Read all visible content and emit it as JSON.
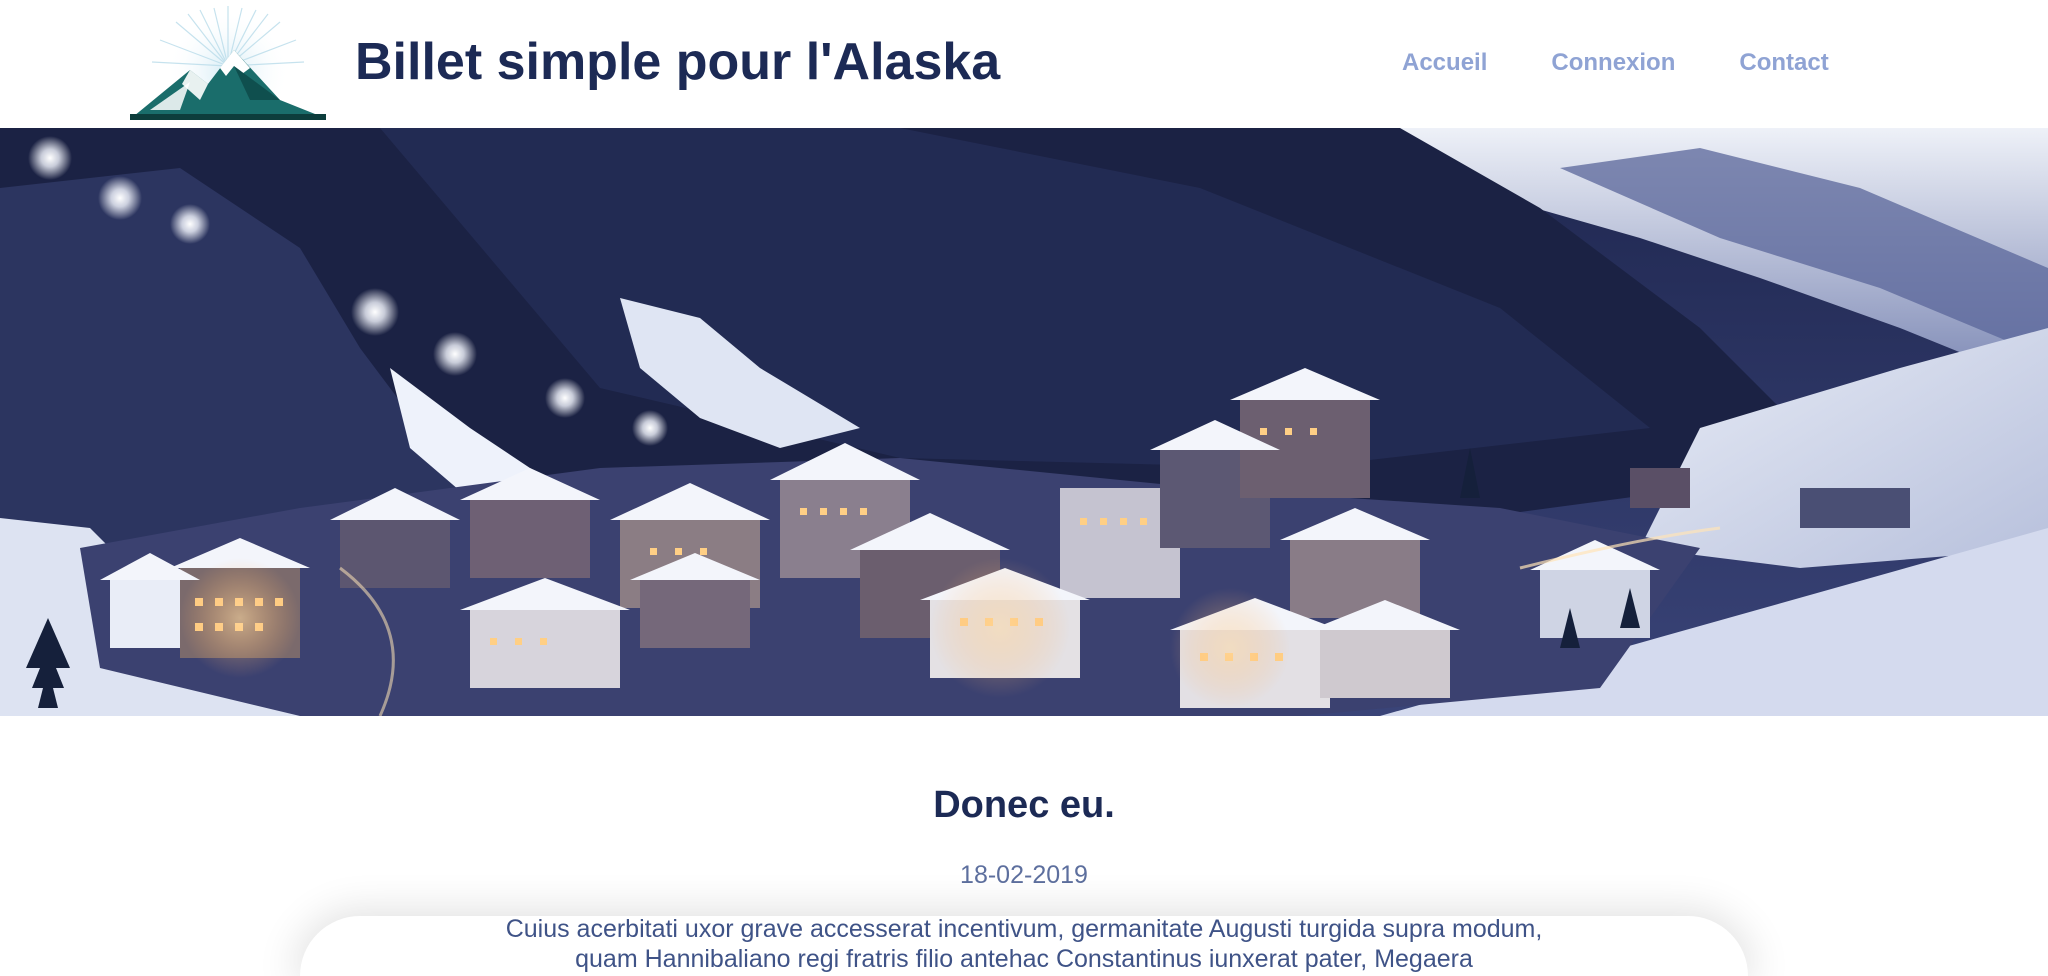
{
  "header": {
    "site_title": "Billet simple pour l'Alaska",
    "logo_icon": "mountain-logo-icon"
  },
  "nav": {
    "items": [
      {
        "label": "Accueil"
      },
      {
        "label": "Connexion"
      },
      {
        "label": "Contact"
      }
    ]
  },
  "hero": {
    "image": "snowy-mountain-village-at-dusk"
  },
  "article": {
    "title": "Donec eu.",
    "date": "18-02-2019",
    "excerpt": "Cuius acerbitati uxor grave accesserat incentivum, germanitate Augusti turgida supra modum, quam Hannibaliano regi fratris filio antehac Constantinus iunxerat pater, Megaera"
  },
  "colors": {
    "title": "#1c2a55",
    "nav": "#8fa3d4",
    "date": "#5d6f9e",
    "body": "#3f5387"
  }
}
